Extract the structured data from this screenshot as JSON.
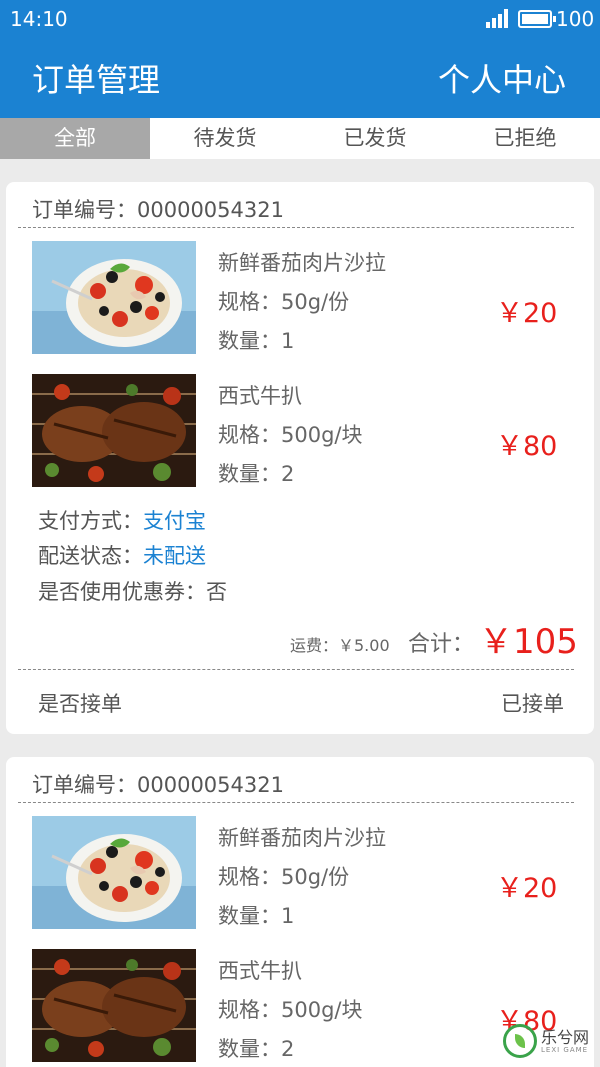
{
  "status_bar": {
    "time": "14:10",
    "battery": "100"
  },
  "header": {
    "title": "订单管理",
    "user_center": "个人中心"
  },
  "tabs": [
    {
      "label": "全部",
      "active": true
    },
    {
      "label": "待发货",
      "active": false
    },
    {
      "label": "已发货",
      "active": false
    },
    {
      "label": "已拒绝",
      "active": false
    }
  ],
  "orders": [
    {
      "order_no": "订单编号：00000054321",
      "items": [
        {
          "name": "新鲜番茄肉片沙拉",
          "spec": "规格：50g/份",
          "qty": "数量：1",
          "price": "￥20"
        },
        {
          "name": "西式牛扒",
          "spec": "规格：500g/块",
          "qty": "数量：2",
          "price": "￥80"
        }
      ],
      "payment_label": "支付方式：",
      "payment_value": "支付宝",
      "delivery_label": "配送状态：",
      "delivery_value": "未配送",
      "coupon": "是否使用优惠券：否",
      "freight": "运费：￥5.00",
      "total_label": "合计：",
      "total_value": "￥105",
      "accept_label": "是否接单",
      "accept_value": "已接单"
    },
    {
      "order_no": "订单编号：00000054321",
      "items": [
        {
          "name": "新鲜番茄肉片沙拉",
          "spec": "规格：50g/份",
          "qty": "数量：1",
          "price": "￥20"
        },
        {
          "name": "西式牛扒",
          "spec": "规格：500g/块",
          "qty": "数量：2",
          "price": "￥80"
        }
      ]
    }
  ],
  "watermark": {
    "text": "乐兮网",
    "sub": "LEXI GAME"
  }
}
